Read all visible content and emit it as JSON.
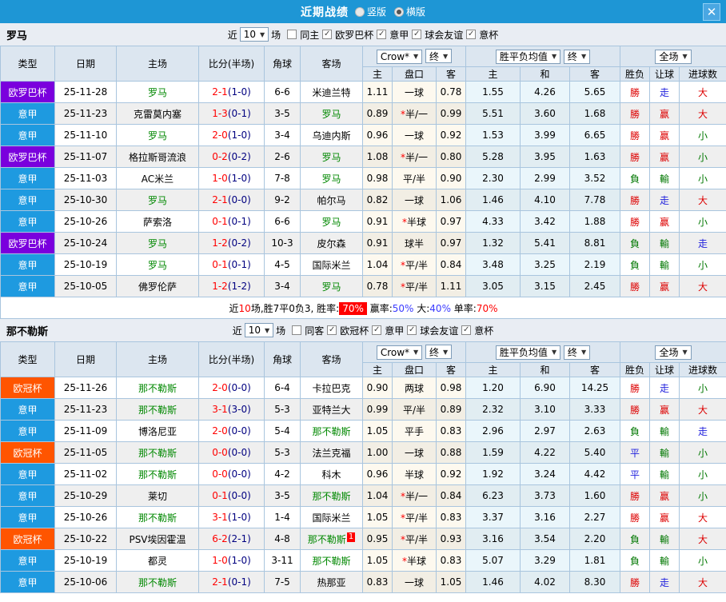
{
  "titlebar": {
    "title": "近期战绩",
    "radios": [
      {
        "label": "竖版",
        "selected": false
      },
      {
        "label": "横版",
        "selected": true
      }
    ],
    "close_icon": "✕"
  },
  "table_header": {
    "left": [
      "类型",
      "日期",
      "主场",
      "比分(半场)",
      "角球",
      "客场"
    ],
    "odds_dropdowns": [
      "Crow*",
      "终"
    ],
    "mean_dropdowns": [
      "胜平负均值",
      "终"
    ],
    "full_dropdown": "全场",
    "sub": [
      "主",
      "盘口",
      "客",
      "主",
      "和",
      "客",
      "胜负",
      "让球",
      "进球数"
    ]
  },
  "colors": {
    "type": {
      "欧罗巴杯": "#7a00dd",
      "意甲": "#1e9ae0",
      "欧冠杯": "#ff5500"
    },
    "result": {
      "勝": "#dd0000",
      "負": "#007700",
      "平": "#2222dd",
      "走": "#2222dd",
      "赢": "#dd0000",
      "輸": "#007700",
      "大": "#dd0000",
      "小": "#007700"
    },
    "team_green": "#008800",
    "score_ft": "#ff0000",
    "score_ht": "#000080",
    "summary_red": "#ff0000",
    "summary_blue": "#3b3bff"
  },
  "sections": [
    {
      "team": "罗马",
      "filter": {
        "near": "近",
        "count": "10",
        "unit": "场",
        "same": "同主",
        "same_checked": false,
        "leagues": [
          "欧罗巴杯",
          "意甲",
          "球会友谊",
          "意杯"
        ]
      },
      "rows": [
        {
          "type": "欧罗巴杯",
          "date": "25-11-28",
          "home": "罗马",
          "ft": "2-1",
          "ht": "1-0",
          "corner": "6-6",
          "away": "米迪兰特",
          "o1": "1.11",
          "hcap": "一球",
          "o2": "0.78",
          "m1": "1.55",
          "m2": "4.26",
          "m3": "5.65",
          "r1": "勝",
          "r2": "走",
          "r3": "大"
        },
        {
          "type": "意甲",
          "date": "25-11-23",
          "home": "克雷莫内塞",
          "ft": "1-3",
          "ht": "0-1",
          "corner": "3-5",
          "away": "罗马",
          "o1": "0.89",
          "hcap": "*半/一",
          "o2": "0.99",
          "m1": "5.51",
          "m2": "3.60",
          "m3": "1.68",
          "r1": "勝",
          "r2": "赢",
          "r3": "大"
        },
        {
          "type": "意甲",
          "date": "25-11-10",
          "home": "罗马",
          "ft": "2-0",
          "ht": "1-0",
          "corner": "3-4",
          "away": "乌迪内斯",
          "o1": "0.96",
          "hcap": "一球",
          "o2": "0.92",
          "m1": "1.53",
          "m2": "3.99",
          "m3": "6.65",
          "r1": "勝",
          "r2": "赢",
          "r3": "小"
        },
        {
          "type": "欧罗巴杯",
          "date": "25-11-07",
          "home": "格拉斯哥流浪",
          "ft": "0-2",
          "ht": "0-2",
          "corner": "2-6",
          "away": "罗马",
          "o1": "1.08",
          "hcap": "*半/一",
          "o2": "0.80",
          "m1": "5.28",
          "m2": "3.95",
          "m3": "1.63",
          "r1": "勝",
          "r2": "赢",
          "r3": "小"
        },
        {
          "type": "意甲",
          "date": "25-11-03",
          "home": "AC米兰",
          "ft": "1-0",
          "ht": "1-0",
          "corner": "7-8",
          "away": "罗马",
          "o1": "0.98",
          "hcap": "平/半",
          "o2": "0.90",
          "m1": "2.30",
          "m2": "2.99",
          "m3": "3.52",
          "r1": "負",
          "r2": "輸",
          "r3": "小"
        },
        {
          "type": "意甲",
          "date": "25-10-30",
          "home": "罗马",
          "ft": "2-1",
          "ht": "0-0",
          "corner": "9-2",
          "away": "帕尔马",
          "o1": "0.82",
          "hcap": "一球",
          "o2": "1.06",
          "m1": "1.46",
          "m2": "4.10",
          "m3": "7.78",
          "r1": "勝",
          "r2": "走",
          "r3": "大"
        },
        {
          "type": "意甲",
          "date": "25-10-26",
          "home": "萨索洛",
          "ft": "0-1",
          "ht": "0-1",
          "corner": "6-6",
          "away": "罗马",
          "o1": "0.91",
          "hcap": "*半球",
          "o2": "0.97",
          "m1": "4.33",
          "m2": "3.42",
          "m3": "1.88",
          "r1": "勝",
          "r2": "赢",
          "r3": "小"
        },
        {
          "type": "欧罗巴杯",
          "date": "25-10-24",
          "home": "罗马",
          "ft": "1-2",
          "ht": "0-2",
          "corner": "10-3",
          "away": "皮尔森",
          "o1": "0.91",
          "hcap": "球半",
          "o2": "0.97",
          "m1": "1.32",
          "m2": "5.41",
          "m3": "8.81",
          "r1": "負",
          "r2": "輸",
          "r3": "走"
        },
        {
          "type": "意甲",
          "date": "25-10-19",
          "home": "罗马",
          "ft": "0-1",
          "ht": "0-1",
          "corner": "4-5",
          "away": "国际米兰",
          "o1": "1.04",
          "hcap": "*平/半",
          "o2": "0.84",
          "m1": "3.48",
          "m2": "3.25",
          "m3": "2.19",
          "r1": "負",
          "r2": "輸",
          "r3": "小"
        },
        {
          "type": "意甲",
          "date": "25-10-05",
          "home": "佛罗伦萨",
          "ft": "1-2",
          "ht": "1-2",
          "corner": "3-4",
          "away": "罗马",
          "o1": "0.78",
          "hcap": "*平/半",
          "o2": "1.11",
          "m1": "3.05",
          "m2": "3.15",
          "m3": "2.45",
          "r1": "勝",
          "r2": "赢",
          "r3": "大"
        }
      ],
      "summary": [
        {
          "t": "近"
        },
        {
          "t": "10",
          "c": "red"
        },
        {
          "t": "场,胜7平0负3, 胜率:"
        },
        {
          "t": "70%",
          "badge": true
        },
        {
          "t": " 赢率:"
        },
        {
          "t": "50%",
          "c": "blue"
        },
        {
          "t": " 大:"
        },
        {
          "t": "40%",
          "c": "blue"
        },
        {
          "t": " 单率:"
        },
        {
          "t": "70%",
          "c": "red"
        }
      ]
    },
    {
      "team": "那不勒斯",
      "filter": {
        "near": "近",
        "count": "10",
        "unit": "场",
        "same": "同客",
        "same_checked": false,
        "leagues": [
          "欧冠杯",
          "意甲",
          "球会友谊",
          "意杯"
        ]
      },
      "rows": [
        {
          "type": "欧冠杯",
          "date": "25-11-26",
          "home": "那不勒斯",
          "ft": "2-0",
          "ht": "0-0",
          "corner": "6-4",
          "away": "卡拉巴克",
          "o1": "0.90",
          "hcap": "两球",
          "o2": "0.98",
          "m1": "1.20",
          "m2": "6.90",
          "m3": "14.25",
          "r1": "勝",
          "r2": "走",
          "r3": "小"
        },
        {
          "type": "意甲",
          "date": "25-11-23",
          "home": "那不勒斯",
          "ft": "3-1",
          "ht": "3-0",
          "corner": "5-3",
          "away": "亚特兰大",
          "o1": "0.99",
          "hcap": "平/半",
          "o2": "0.89",
          "m1": "2.32",
          "m2": "3.10",
          "m3": "3.33",
          "r1": "勝",
          "r2": "赢",
          "r3": "大"
        },
        {
          "type": "意甲",
          "date": "25-11-09",
          "home": "博洛尼亚",
          "ft": "2-0",
          "ht": "0-0",
          "corner": "5-4",
          "away": "那不勒斯",
          "o1": "1.05",
          "hcap": "平手",
          "o2": "0.83",
          "m1": "2.96",
          "m2": "2.97",
          "m3": "2.63",
          "r1": "負",
          "r2": "輸",
          "r3": "走"
        },
        {
          "type": "欧冠杯",
          "date": "25-11-05",
          "home": "那不勒斯",
          "ft": "0-0",
          "ht": "0-0",
          "corner": "5-3",
          "away": "法兰克福",
          "o1": "1.00",
          "hcap": "一球",
          "o2": "0.88",
          "m1": "1.59",
          "m2": "4.22",
          "m3": "5.40",
          "r1": "平",
          "r2": "輸",
          "r3": "小"
        },
        {
          "type": "意甲",
          "date": "25-11-02",
          "home": "那不勒斯",
          "ft": "0-0",
          "ht": "0-0",
          "corner": "4-2",
          "away": "科木",
          "o1": "0.96",
          "hcap": "半球",
          "o2": "0.92",
          "m1": "1.92",
          "m2": "3.24",
          "m3": "4.42",
          "r1": "平",
          "r2": "輸",
          "r3": "小"
        },
        {
          "type": "意甲",
          "date": "25-10-29",
          "home": "莱切",
          "ft": "0-1",
          "ht": "0-0",
          "corner": "3-5",
          "away": "那不勒斯",
          "o1": "1.04",
          "hcap": "*半/一",
          "o2": "0.84",
          "m1": "6.23",
          "m2": "3.73",
          "m3": "1.60",
          "r1": "勝",
          "r2": "赢",
          "r3": "小"
        },
        {
          "type": "意甲",
          "date": "25-10-26",
          "home": "那不勒斯",
          "ft": "3-1",
          "ht": "1-0",
          "corner": "1-4",
          "away": "国际米兰",
          "o1": "1.05",
          "hcap": "*平/半",
          "o2": "0.83",
          "m1": "3.37",
          "m2": "3.16",
          "m3": "2.27",
          "r1": "勝",
          "r2": "赢",
          "r3": "大"
        },
        {
          "type": "欧冠杯",
          "date": "25-10-22",
          "home": "PSV埃因霍温",
          "ft": "6-2",
          "ht": "2-1",
          "corner": "4-8",
          "away": "那不勒斯",
          "away_badge": "1",
          "o1": "0.95",
          "hcap": "*平/半",
          "o2": "0.93",
          "m1": "3.16",
          "m2": "3.54",
          "m3": "2.20",
          "r1": "負",
          "r2": "輸",
          "r3": "大"
        },
        {
          "type": "意甲",
          "date": "25-10-19",
          "home": "都灵",
          "ft": "1-0",
          "ht": "1-0",
          "corner": "3-11",
          "away": "那不勒斯",
          "o1": "1.05",
          "hcap": "*半球",
          "o2": "0.83",
          "m1": "5.07",
          "m2": "3.29",
          "m3": "1.81",
          "r1": "負",
          "r2": "輸",
          "r3": "小"
        },
        {
          "type": "意甲",
          "date": "25-10-06",
          "home": "那不勒斯",
          "ft": "2-1",
          "ht": "0-1",
          "corner": "7-5",
          "away": "热那亚",
          "o1": "0.83",
          "hcap": "一球",
          "o2": "1.05",
          "m1": "1.46",
          "m2": "4.02",
          "m3": "8.30",
          "r1": "勝",
          "r2": "走",
          "r3": "大"
        }
      ],
      "summary": null
    }
  ]
}
